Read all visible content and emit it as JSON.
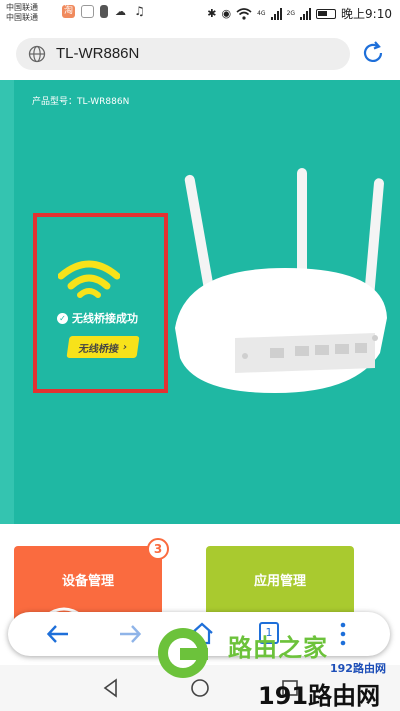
{
  "status_bar": {
    "carrier_1": "中国联通",
    "carrier_2": "中国联通",
    "network_1": "4G",
    "network_2": "2G",
    "time": "晚上9:10",
    "battery_level": 0.45
  },
  "browser": {
    "url": "TL-WR886N"
  },
  "page": {
    "product_model": "产品型号：TL-WR886N",
    "bridge_status": "无线桥接成功",
    "bridge_button": "无线桥接",
    "device_card_title": "设备管理",
    "device_count_badge": "3",
    "app_card_title": "应用管理"
  },
  "toolbar": {
    "tab_count": "1"
  },
  "watermark": {
    "text_1": "路由之家",
    "text_2": "192路由网",
    "text_3": "191路由网"
  },
  "colors": {
    "hero_background": "#1fb8a3",
    "highlight_border": "#e23232",
    "wifi_yellow": "#f7e21a",
    "device_card": "#fa6b3f",
    "app_card": "#a9ca2f",
    "accent_blue": "#1e6fd9",
    "watermark_green": "#6cc23b"
  },
  "icons": {
    "globe": "globe-icon",
    "reload": "reload-icon",
    "back": "back-arrow-icon",
    "forward": "forward-arrow-icon",
    "home": "home-icon",
    "menu": "more-vertical-icon",
    "wifi": "wifi-icon",
    "check": "check-circle-icon"
  }
}
